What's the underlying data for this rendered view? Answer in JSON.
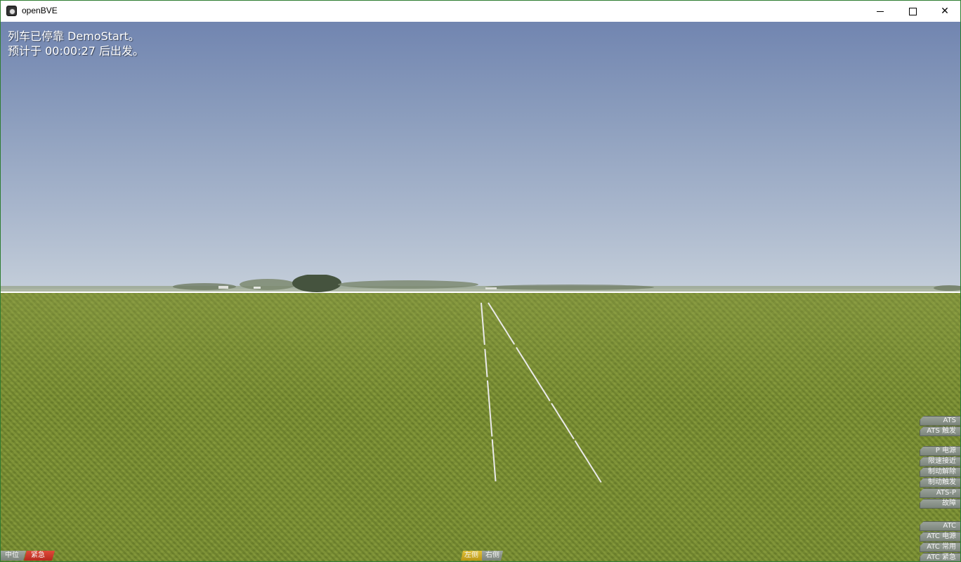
{
  "window": {
    "title": "openBVE",
    "minimize_glyph": "minimize-icon",
    "maximize_glyph": "maximize-icon",
    "close_label": "✕"
  },
  "messages": {
    "line1": "列车已停靠 DemoStart。",
    "line2": "预计于 00:00:27 后出发。"
  },
  "panel_ats": [
    "ATS",
    "ATS 触发"
  ],
  "panel_atsp": [
    "P 电源",
    "限速接近",
    "制动解除",
    "制动触发",
    "ATS-P",
    "故障"
  ],
  "panel_atc": [
    "ATC",
    "ATC 电源",
    "ATC 常用",
    "ATC 紧急"
  ],
  "bottom_left": {
    "neutral": "中位",
    "emergency": "紧急"
  },
  "bottom_center": {
    "left_door": "左侧",
    "right_door": "右侧"
  },
  "colors": {
    "sky_top": "#7185b0",
    "sky_horizon": "#c3cdd9",
    "grass": "#7d9136",
    "rail": "#e8e8e8",
    "emergency": "#d63a2c",
    "door_active": "#d4b02a",
    "indicator": "#8a928a"
  }
}
